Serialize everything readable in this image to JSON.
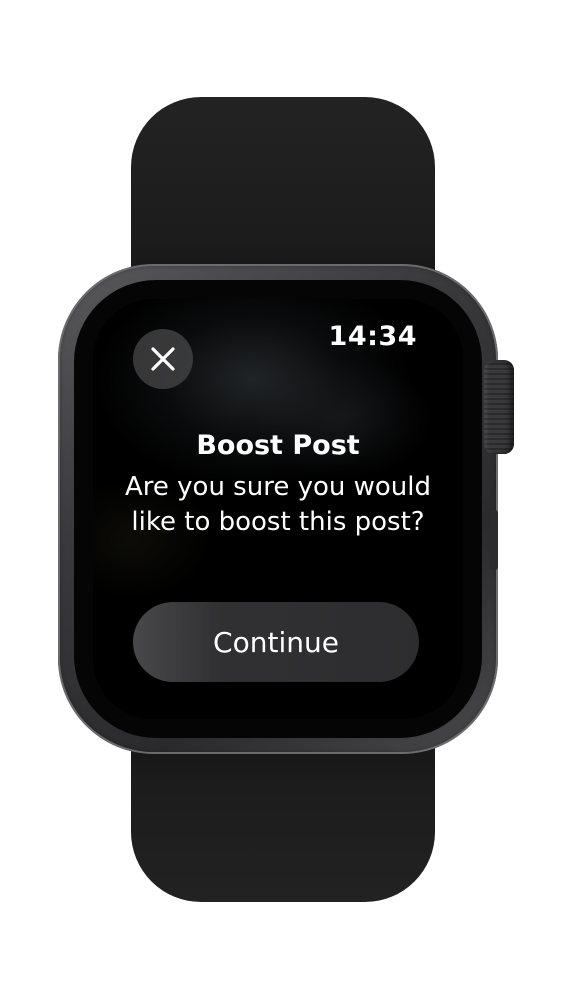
{
  "status_bar": {
    "time": "14:34"
  },
  "dialog": {
    "title": "Boost Post",
    "message": "Are you sure you would like to boost this post?",
    "continue_label": "Continue",
    "close_icon": "close-icon"
  },
  "colors": {
    "screen_background": "#000000",
    "text": "#ffffff",
    "button_fill": "#3a3a3c",
    "watch_band": "#1c1c1c",
    "watch_case": "#3a3a3c"
  }
}
